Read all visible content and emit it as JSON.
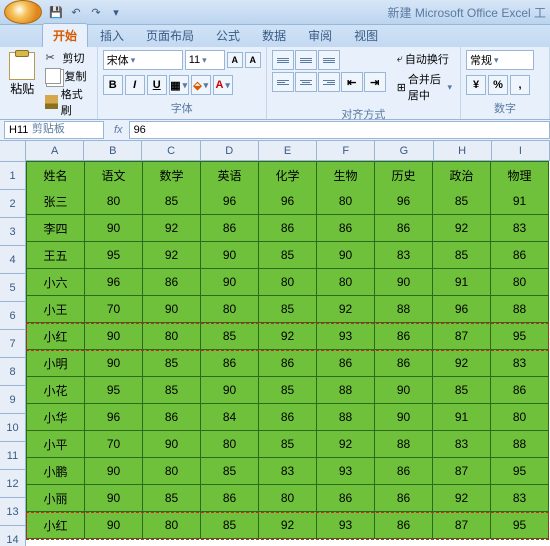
{
  "title": "新建 Microsoft Office Excel 工",
  "tabs": [
    "开始",
    "插入",
    "页面布局",
    "公式",
    "数据",
    "审阅",
    "视图"
  ],
  "activeTab": 0,
  "clipboard": {
    "paste": "粘贴",
    "cut": "剪切",
    "copy": "复制",
    "brush": "格式刷",
    "label": "剪贴板"
  },
  "font": {
    "name": "宋体",
    "size": "11",
    "label": "字体"
  },
  "align": {
    "wrap": "自动换行",
    "merge": "合并后居中",
    "label": "对齐方式"
  },
  "number": {
    "format": "常规",
    "label": "数字"
  },
  "cellRef": "H11",
  "formulaValue": "96",
  "columns": [
    "A",
    "B",
    "C",
    "D",
    "E",
    "F",
    "G",
    "H",
    "I"
  ],
  "rowNumbers": [
    "1",
    "2",
    "3",
    "4",
    "5",
    "6",
    "7",
    "8",
    "9",
    "10",
    "11",
    "12",
    "13",
    "14"
  ],
  "chart_data": {
    "type": "table",
    "headers": [
      "姓名",
      "语文",
      "数学",
      "英语",
      "化学",
      "生物",
      "历史",
      "政治",
      "物理"
    ],
    "rows": [
      [
        "张三",
        "80",
        "85",
        "96",
        "96",
        "80",
        "96",
        "85",
        "91"
      ],
      [
        "李四",
        "90",
        "92",
        "86",
        "86",
        "86",
        "86",
        "92",
        "83"
      ],
      [
        "王五",
        "95",
        "92",
        "90",
        "85",
        "90",
        "83",
        "85",
        "86"
      ],
      [
        "小六",
        "96",
        "86",
        "90",
        "80",
        "80",
        "90",
        "91",
        "80"
      ],
      [
        "小王",
        "70",
        "90",
        "80",
        "85",
        "92",
        "88",
        "96",
        "88"
      ],
      [
        "小红",
        "90",
        "80",
        "85",
        "92",
        "93",
        "86",
        "87",
        "95"
      ],
      [
        "小明",
        "90",
        "85",
        "86",
        "86",
        "86",
        "86",
        "92",
        "83"
      ],
      [
        "小花",
        "95",
        "85",
        "90",
        "85",
        "88",
        "90",
        "85",
        "86"
      ],
      [
        "小华",
        "96",
        "86",
        "84",
        "86",
        "88",
        "90",
        "91",
        "80"
      ],
      [
        "小平",
        "70",
        "90",
        "80",
        "85",
        "92",
        "88",
        "83",
        "88"
      ],
      [
        "小鹏",
        "90",
        "80",
        "85",
        "83",
        "93",
        "86",
        "87",
        "95"
      ],
      [
        "小丽",
        "90",
        "85",
        "86",
        "80",
        "86",
        "86",
        "92",
        "83"
      ],
      [
        "小红",
        "90",
        "80",
        "85",
        "92",
        "93",
        "86",
        "87",
        "95"
      ]
    ]
  },
  "highlightRows": [
    6,
    13
  ]
}
